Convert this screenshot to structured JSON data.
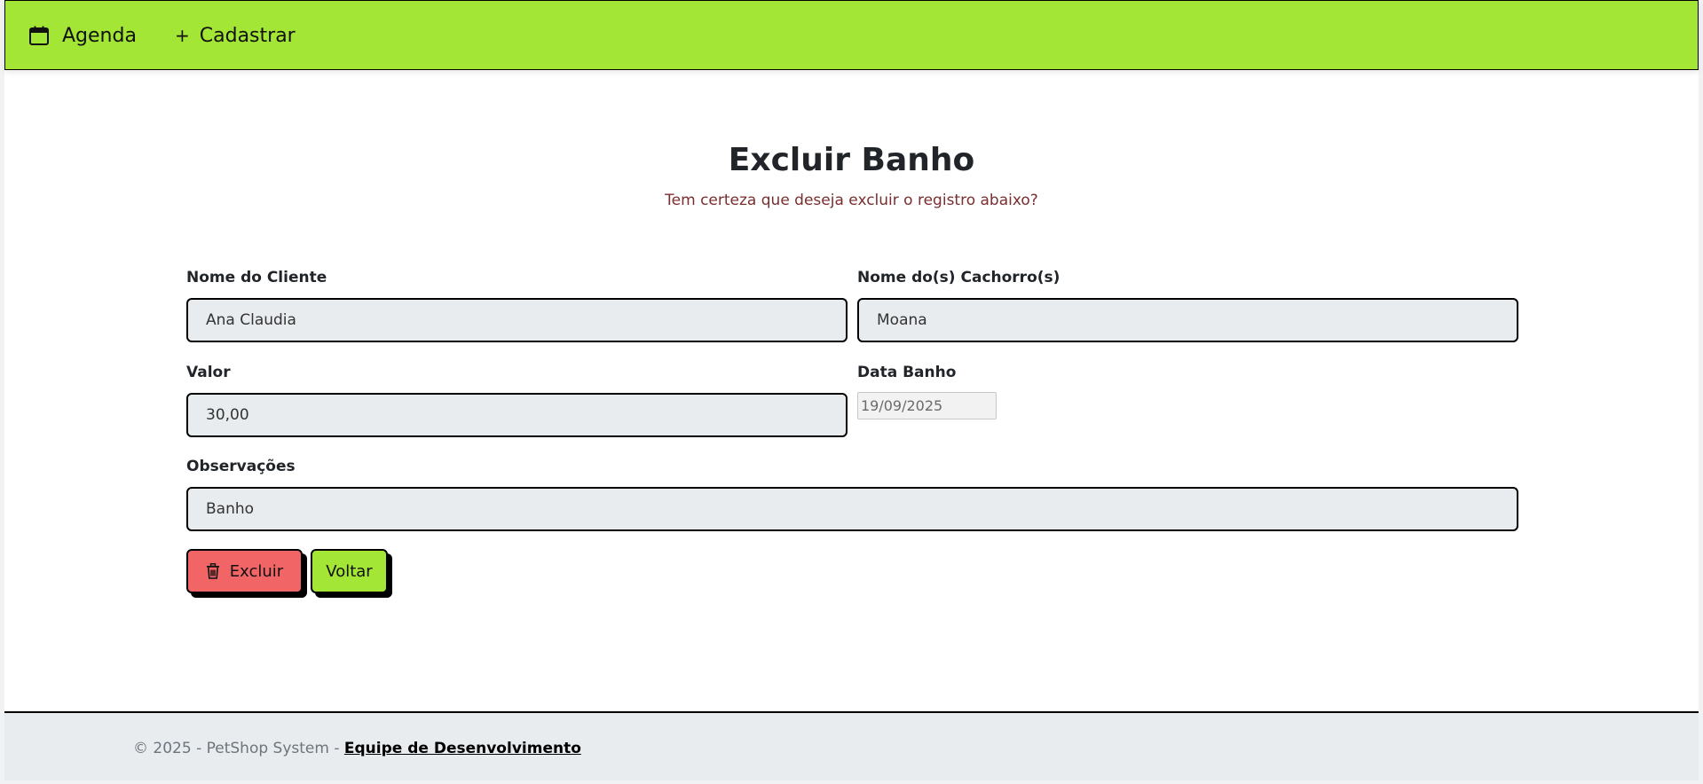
{
  "navbar": {
    "brand_color": "#a3e635",
    "items": [
      {
        "label": "Agenda",
        "icon": "calendar-icon"
      },
      {
        "label": "Cadastrar",
        "icon": "plus-icon",
        "icon_glyph": "+"
      }
    ]
  },
  "page": {
    "title": "Excluir Banho",
    "subtitle": "Tem certeza que deseja excluir o registro abaixo?"
  },
  "form": {
    "cliente": {
      "label": "Nome do Cliente",
      "value": "Ana Claudia"
    },
    "cachorro": {
      "label": "Nome do(s) Cachorro(s)",
      "value": "Moana"
    },
    "valor": {
      "label": "Valor",
      "value": "30,00"
    },
    "data": {
      "label": "Data Banho",
      "value": "19/09/2025"
    },
    "observacoes": {
      "label": "Observações",
      "value": "Banho"
    }
  },
  "actions": {
    "delete_label": "Excluir",
    "delete_icon": "trash-icon",
    "delete_color": "#f26566",
    "back_label": "Voltar",
    "back_color": "#a3e635"
  },
  "footer": {
    "copyright": "© 2025 - PetShop System - ",
    "link_label": "Equipe de Desenvolvimento"
  }
}
